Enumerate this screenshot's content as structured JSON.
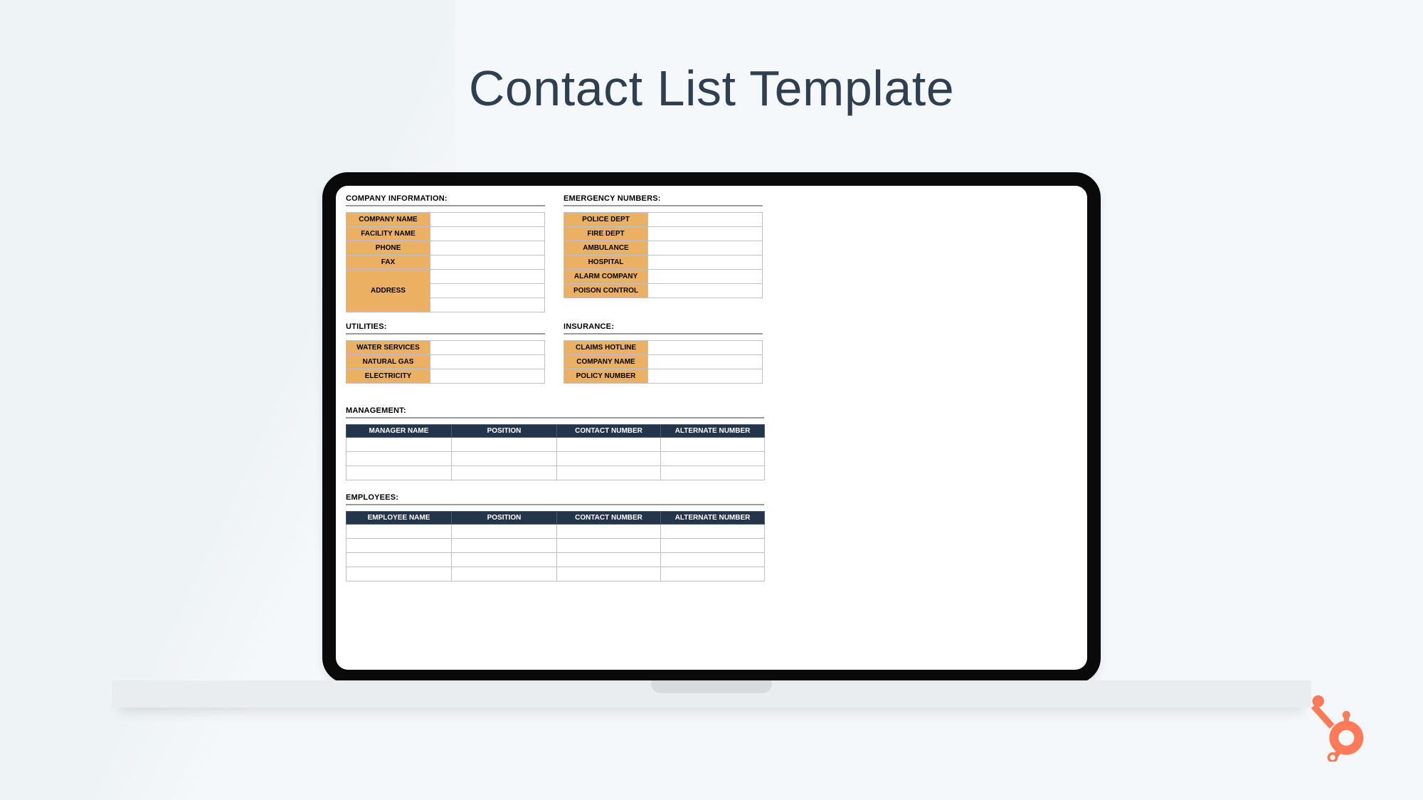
{
  "title": "Contact List Template",
  "sections": {
    "company": {
      "heading": "COMPANY INFORMATION:",
      "rows": [
        "COMPANY NAME",
        "FACILITY NAME",
        "PHONE",
        "FAX"
      ],
      "address_label": "ADDRESS"
    },
    "emergency": {
      "heading": "EMERGENCY NUMBERS:",
      "rows": [
        "POLICE DEPT",
        "FIRE DEPT",
        "AMBULANCE",
        "HOSPITAL",
        "ALARM COMPANY",
        "POISON CONTROL"
      ]
    },
    "utilities": {
      "heading": "UTILITIES:",
      "rows": [
        "WATER SERVICES",
        "NATURAL GAS",
        "ELECTRICITY"
      ]
    },
    "insurance": {
      "heading": "INSURANCE:",
      "rows": [
        "CLAIMS HOTLINE",
        "COMPANY NAME",
        "POLICY NUMBER"
      ]
    },
    "management": {
      "heading": "MANAGEMENT:",
      "cols": [
        "MANAGER NAME",
        "POSITION",
        "CONTACT NUMBER",
        "ALTERNATE NUMBER"
      ]
    },
    "employees": {
      "heading": "EMPLOYEES:",
      "cols": [
        "EMPLOYEE NAME",
        "POSITION",
        "CONTACT NUMBER",
        "ALTERNATE NUMBER"
      ]
    }
  },
  "colors": {
    "accent_label": "#ecb063",
    "header_dark": "#24344a",
    "brand": "#ff7a59"
  }
}
